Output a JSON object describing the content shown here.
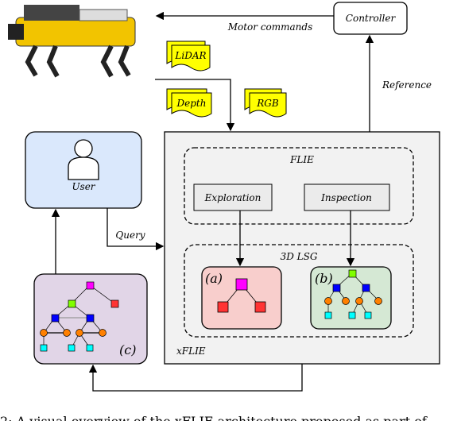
{
  "labels": {
    "controller": "Controller",
    "motor_commands": "Motor commands",
    "reference": "Reference",
    "lidar": "LiDAR",
    "depth": "Depth",
    "rgb": "RGB",
    "user": "User",
    "query": "Query",
    "flie": "FLIE",
    "exploration": "Exploration",
    "inspection": "Inspection",
    "lsg": "3D LSG",
    "a": "(a)",
    "b": "(b)",
    "c": "(c)",
    "xflie": "xFLIE"
  },
  "caption": "2: A visual overview of the xFLIE architecture proposed as part of",
  "colors": {
    "sensor": "#ffff00",
    "user_box": "#dae8fc",
    "panel": "#f2f2f2",
    "box_a": "#f8cecc",
    "box_b": "#d5e8d4",
    "box_c": "#e1d5e7",
    "node_magenta": "#ff00ff",
    "node_green": "#80ff00",
    "node_red": "#ff3333",
    "node_blue": "#0000ff",
    "node_orange": "#ff8000",
    "node_cyan": "#00ffff"
  }
}
